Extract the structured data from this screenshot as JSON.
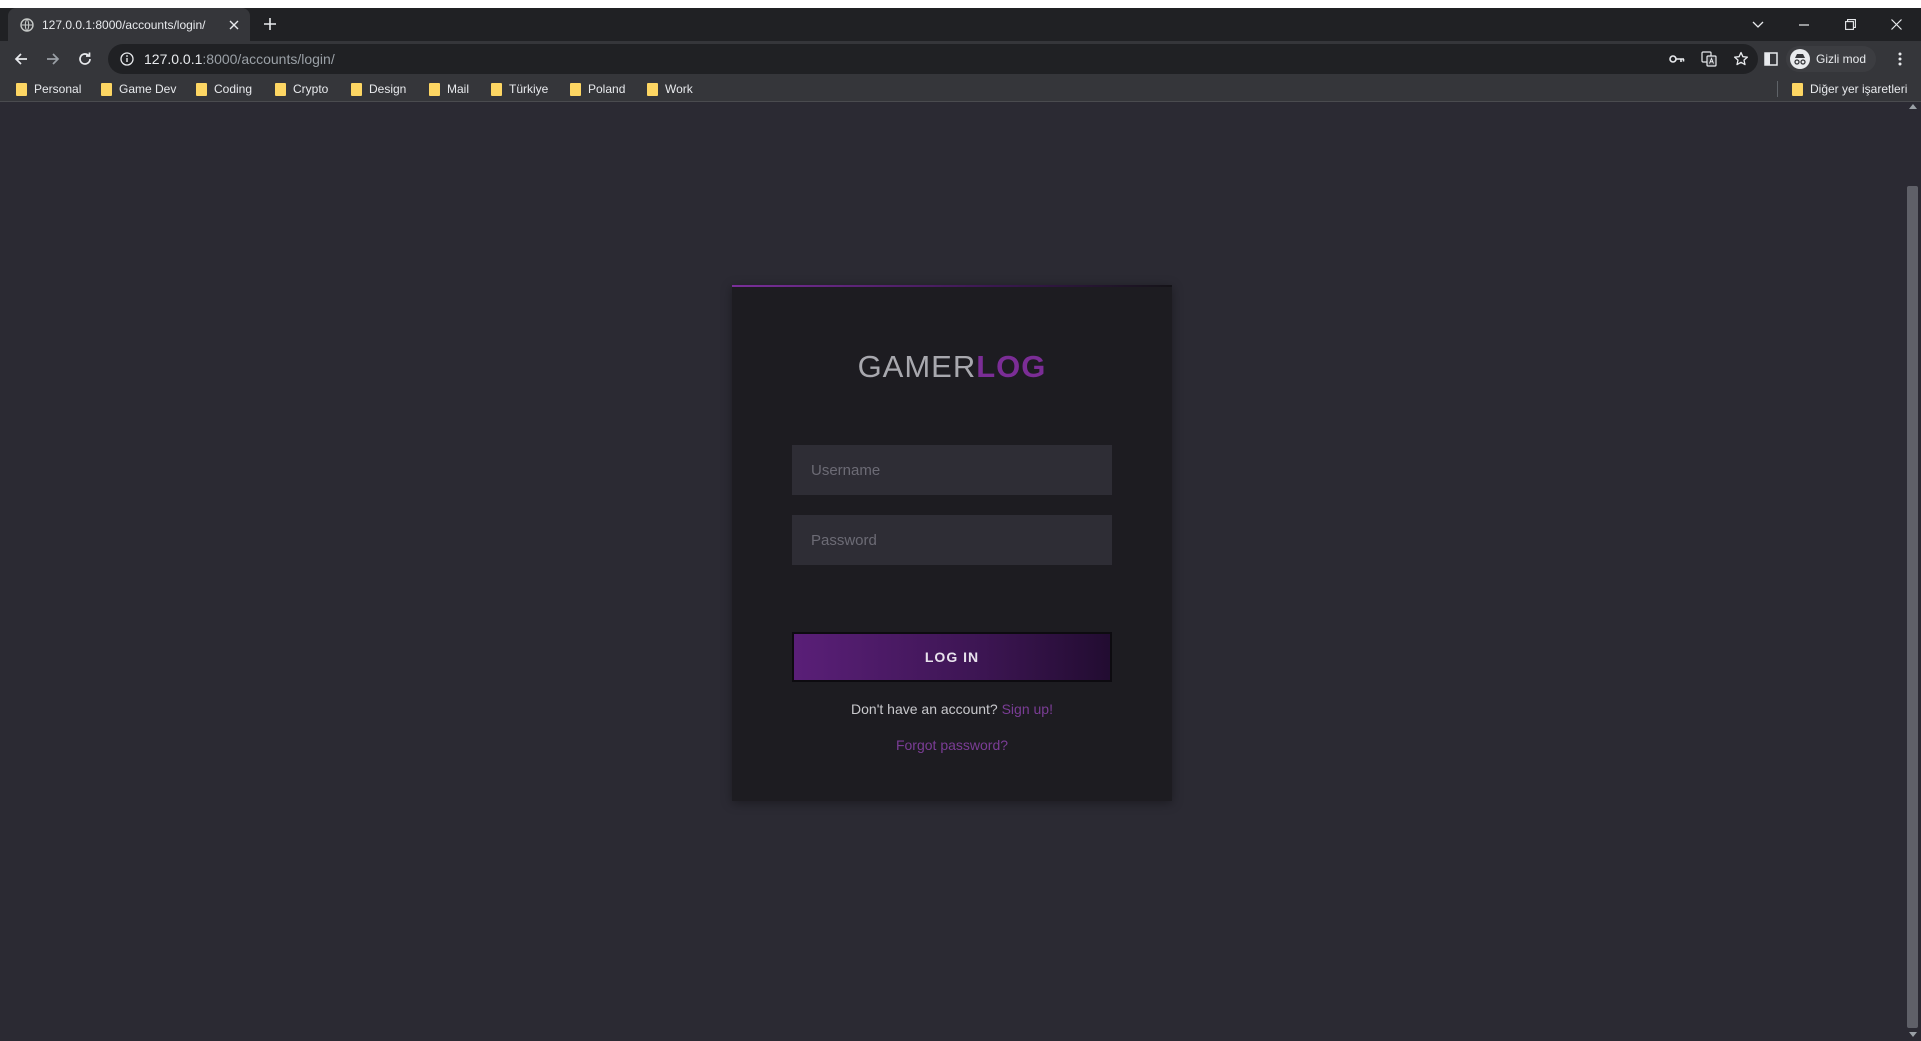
{
  "browser": {
    "tab": {
      "title": "127.0.0.1:8000/accounts/login/"
    },
    "url": {
      "host": "127.0.0.1",
      "rest": ":8000/accounts/login/"
    },
    "profile_label": "Gizli mod",
    "bookmarks": [
      {
        "label": "Personal"
      },
      {
        "label": "Game Dev"
      },
      {
        "label": "Coding"
      },
      {
        "label": "Crypto"
      },
      {
        "label": "Design"
      },
      {
        "label": "Mail"
      },
      {
        "label": "Türkiye"
      },
      {
        "label": "Poland"
      },
      {
        "label": "Work"
      }
    ],
    "other_bookmarks": "Diğer yer işaretleri"
  },
  "login": {
    "logo_part1": "GAMER",
    "logo_part2": "LOG",
    "username_placeholder": "Username",
    "password_placeholder": "Password",
    "submit_label": "LOG IN",
    "signup_prompt": "Don't have an account? ",
    "signup_link": "Sign up",
    "signup_suffix": "!",
    "forgot_link": "Forgot password?"
  },
  "colors": {
    "page_background": "#2b2a33",
    "card_background": "#1d1c21",
    "accent_purple": "#7b2d96",
    "input_background": "#2e2d35"
  }
}
